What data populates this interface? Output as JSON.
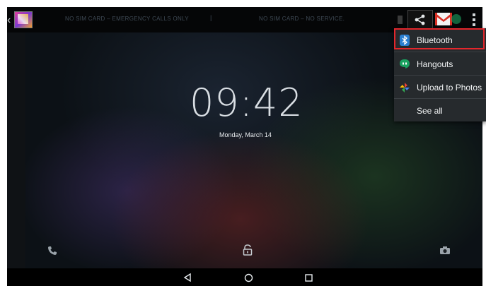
{
  "status_bar": {
    "sim_left": "NO SIM CARD – EMERGENCY CALLS ONLY",
    "separator": "|",
    "sim_right": "NO SIM CARD – NO SERVICE."
  },
  "lockscreen": {
    "time": "09:42",
    "date": "Monday, March 14"
  },
  "share_menu": {
    "items": [
      {
        "label": "Bluetooth",
        "icon": "bluetooth-icon"
      },
      {
        "label": "Hangouts",
        "icon": "hangouts-icon"
      },
      {
        "label": "Upload to Photos",
        "icon": "photos-icon"
      },
      {
        "label": "See all",
        "icon": ""
      }
    ]
  },
  "colors": {
    "highlight": "#e3262b",
    "menu_bg": "#262a2d"
  }
}
